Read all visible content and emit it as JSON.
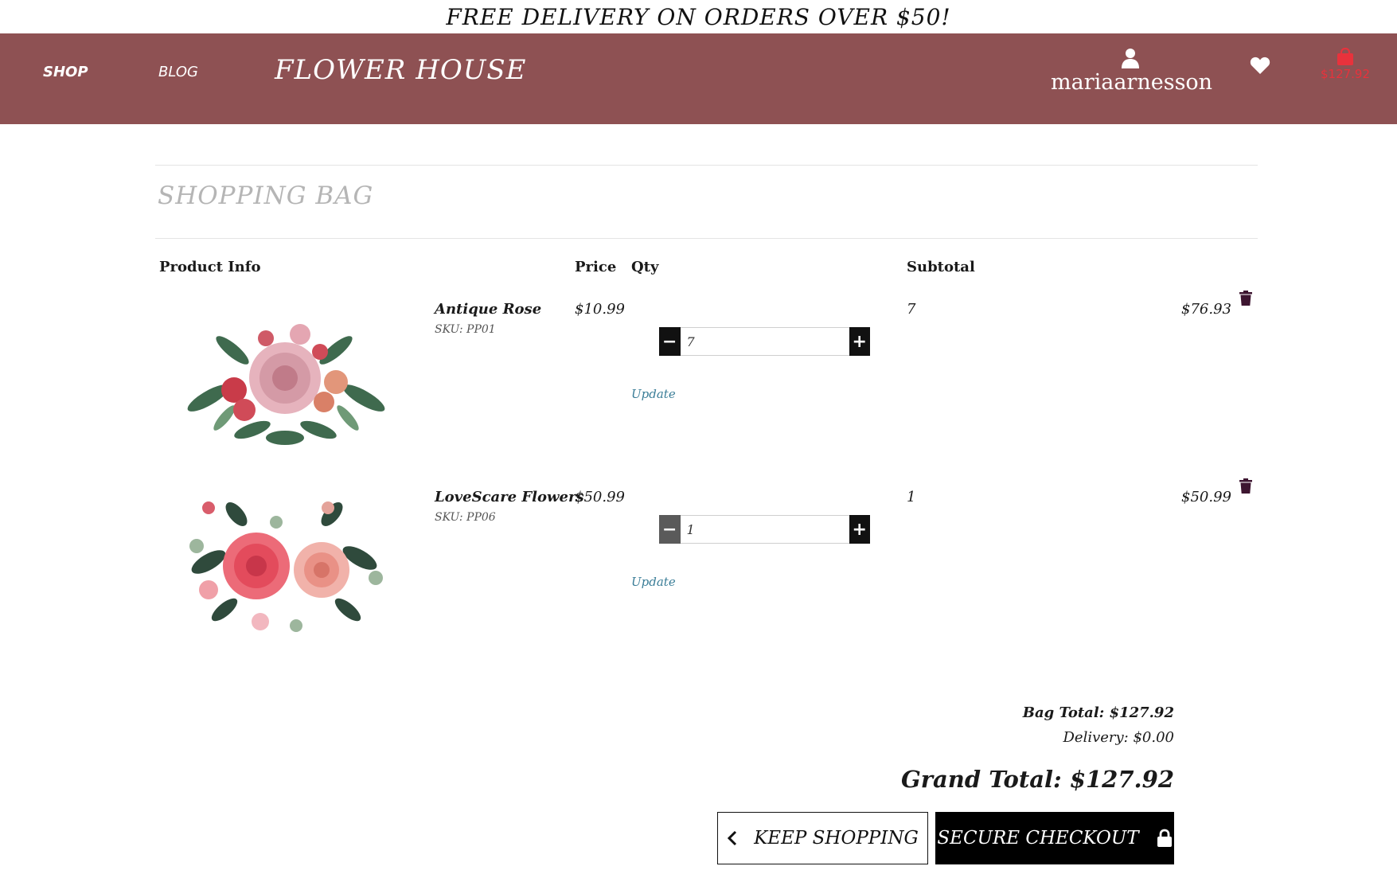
{
  "banner": {
    "text": "FREE DELIVERY ON ORDERS OVER $50!"
  },
  "nav": {
    "shop": "SHOP",
    "blog": "BLOG",
    "logo": "FLOWER HOUSE",
    "account_name": "mariaarnesson",
    "account_icon": "user-icon",
    "wishlist_icon": "heart-icon",
    "bag_icon": "shopping-bag-icon",
    "bag_total": "$127.92",
    "bar_color": "#8e5153",
    "bag_total_color": "#e8323c"
  },
  "page": {
    "title": "SHOPPING BAG"
  },
  "table": {
    "headers": {
      "product": "Product Info",
      "price": "Price",
      "qty": "Qty",
      "subtotal": "Subtotal"
    }
  },
  "items": [
    {
      "name": "Antique Rose",
      "sku": "SKU: PP01",
      "price": "$10.99",
      "qty": "7",
      "subtotal_qty": "7",
      "subtotal": "$76.93",
      "update_label": "Update",
      "image": "antique-rose-bouquet"
    },
    {
      "name": "LoveScare Flowers",
      "sku": "SKU: PP06",
      "price": "$50.99",
      "qty": "1",
      "subtotal_qty": "1",
      "subtotal": "$50.99",
      "update_label": "Update",
      "image": "lovescare-flowers-bouquet"
    }
  ],
  "summary": {
    "bag_total": "Bag Total: $127.92",
    "delivery": "Delivery: $0.00",
    "grand_total": "Grand Total: $127.92"
  },
  "buttons": {
    "keep_shopping": "KEEP SHOPPING",
    "secure_checkout": "SECURE CHECKOUT"
  }
}
